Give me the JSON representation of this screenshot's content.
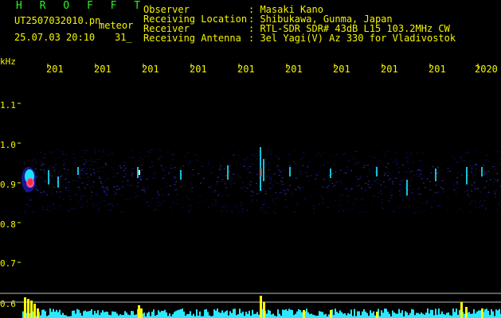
{
  "header": {
    "title": "H R O F F T",
    "filename": "UT2507032010.pn",
    "kind": "meteor",
    "datetime": "25.07.03 20:10",
    "frame": "31_"
  },
  "info": [
    {
      "label": "Observer",
      "value": ": Masaki Kano"
    },
    {
      "label": "Receiving Location",
      "value": ": Shibukawa, Gunma, Japan"
    },
    {
      "label": "Receiver",
      "value": ": RTL-SDR SDR# 43dB L15 103.2MHz CW"
    },
    {
      "label": "Receiving Antenna",
      "value": ": 3el Yagi(V) Az 330 for Vladivostok"
    }
  ],
  "axis": {
    "unit": "kHz",
    "x_ticks": [
      "201",
      "201",
      "201",
      "201",
      "201",
      "201",
      "201",
      "201",
      "201",
      "2020"
    ],
    "y_ticks": [
      "1.1",
      "1.0",
      "0.9",
      "0.8",
      "0.7",
      "0.6"
    ]
  },
  "colors": {
    "text": "#f5f500",
    "title": "#2cf02c",
    "background": "#000000",
    "signal_low": "#1a1aa0",
    "signal_mid": "#19e0ff",
    "signal_high": "#ff2a2a",
    "count_bar": "#ffff00",
    "count_floor": "#29e8ff",
    "grid": "#ffffff"
  }
}
